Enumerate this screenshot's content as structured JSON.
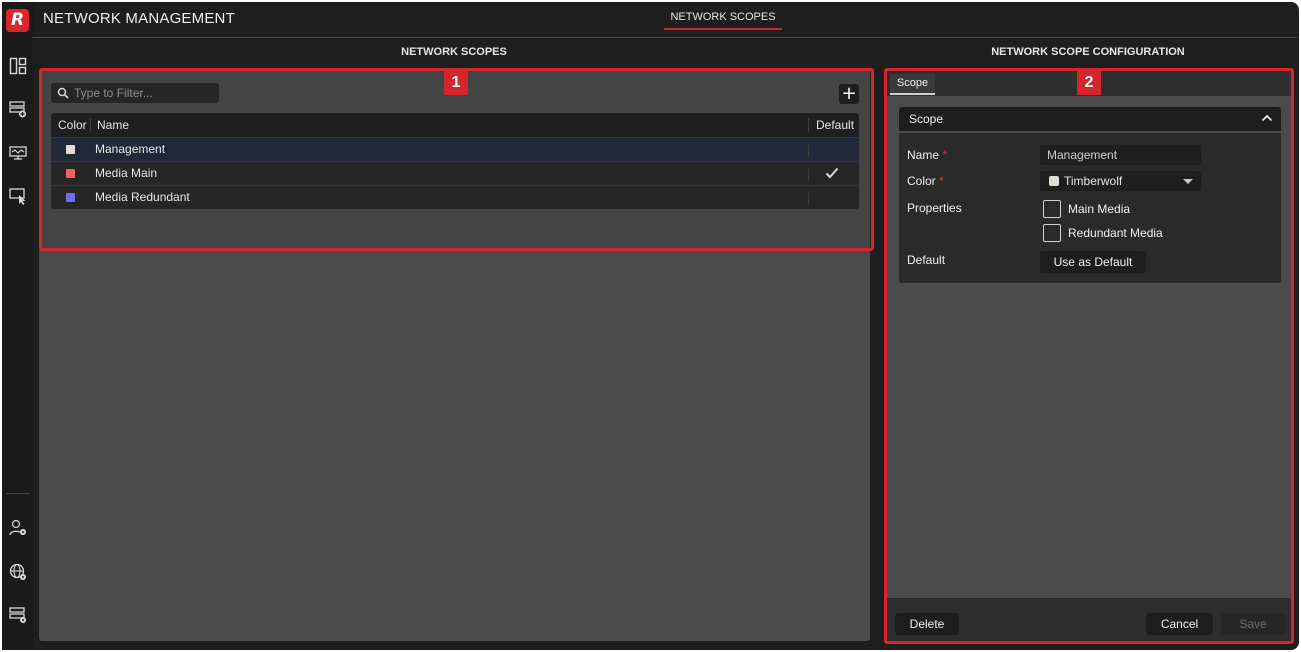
{
  "app": {
    "logo_letter": "R",
    "title": "NETWORK MANAGEMENT",
    "header_tab": "NETWORK SCOPES"
  },
  "rail": {
    "icons": [
      "layout-icon",
      "device-add-icon",
      "monitor-network-icon",
      "device-pointer-icon",
      "user-settings-icon",
      "globe-settings-icon",
      "device-settings-icon"
    ]
  },
  "left_panel": {
    "title": "NETWORK SCOPES",
    "filter_placeholder": "Type to Filter...",
    "add_label": "+",
    "columns": {
      "color": "Color",
      "name": "Name",
      "default": "Default"
    },
    "rows": [
      {
        "name": "Management",
        "color": "#e2dcd6",
        "is_default": false,
        "selected": true
      },
      {
        "name": "Media Main",
        "color": "#f0625e",
        "is_default": true,
        "selected": false
      },
      {
        "name": "Media Redundant",
        "color": "#6f6ef2",
        "is_default": false,
        "selected": false
      }
    ]
  },
  "right_panel": {
    "title": "NETWORK SCOPE CONFIGURATION",
    "tab": "Scope",
    "section_title": "Scope",
    "fields": {
      "name_label": "Name",
      "name_value": "Management",
      "color_label": "Color",
      "color_value": "Timberwolf",
      "properties_label": "Properties",
      "main_media_label": "Main Media",
      "redundant_media_label": "Redundant Media",
      "default_label": "Default",
      "use_default_label": "Use as Default",
      "required_mark": "*"
    },
    "buttons": {
      "delete": "Delete",
      "cancel": "Cancel",
      "save": "Save"
    }
  },
  "callouts": {
    "one": "1",
    "two": "2"
  },
  "colors": {
    "accent": "#d4262c",
    "panel": "#4b4b4b",
    "dark": "#1e1e1e"
  }
}
